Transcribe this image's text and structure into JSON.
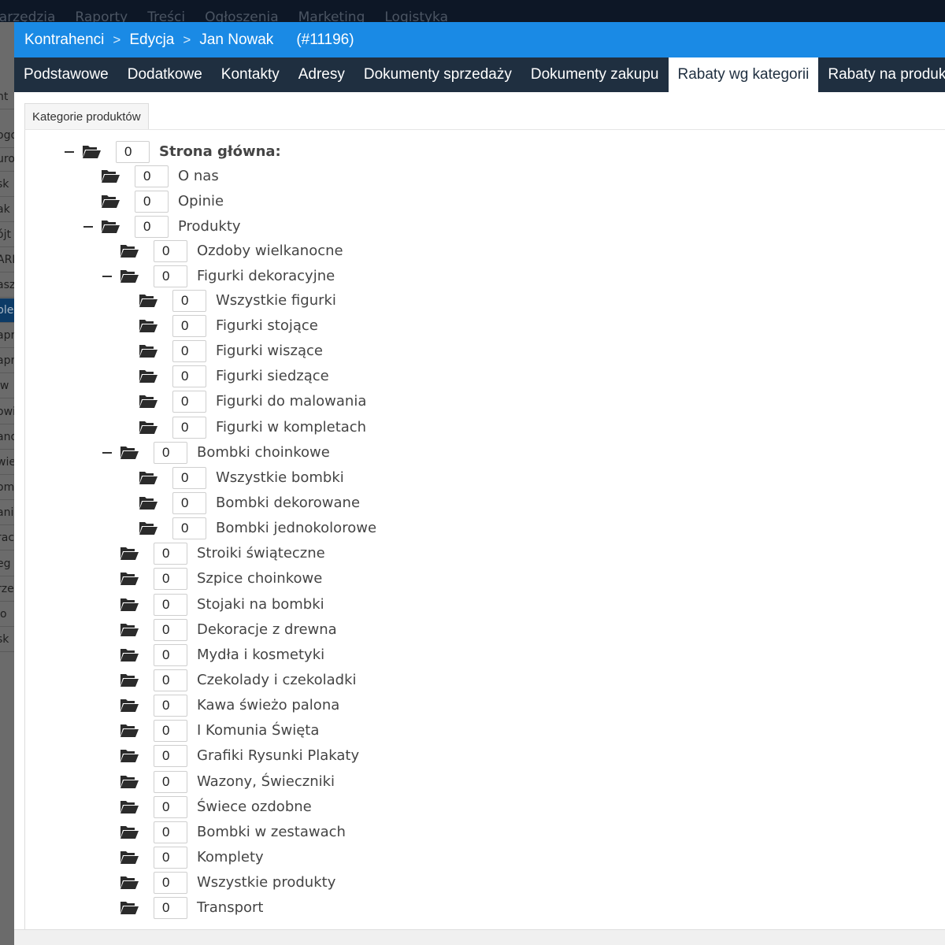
{
  "background": {
    "top_menu": [
      "narzędzia",
      "Raporty",
      "Treści",
      "Ogłoszenia",
      "Marketing",
      "Logistyka"
    ],
    "side_fragments": [
      "nt",
      "ogo",
      "uro",
      "sk",
      "ak",
      "ójt",
      "ARF",
      "asz",
      "ple",
      "apr",
      "apr",
      "iw",
      "owi",
      "and",
      "wie",
      "om",
      "ani",
      "rac",
      "eg",
      "rze",
      "ło",
      "sk"
    ]
  },
  "breadcrumb": {
    "items": [
      "Kontrahenci",
      "Edycja",
      "Jan Nowak"
    ],
    "separator": ">",
    "record": "(#11196)"
  },
  "tabs": [
    {
      "label": "Podstawowe"
    },
    {
      "label": "Dodatkowe"
    },
    {
      "label": "Kontakty"
    },
    {
      "label": "Adresy"
    },
    {
      "label": "Dokumenty sprzedaży"
    },
    {
      "label": "Dokumenty zakupu"
    },
    {
      "label": "Rabaty wg kategorii",
      "active": true
    },
    {
      "label": "Rabaty na produkty"
    }
  ],
  "subtab": "Kategorie produktów",
  "tree": [
    {
      "label": "Strona główna:",
      "value": "0",
      "level": 0,
      "expanded": true,
      "root": true
    },
    {
      "label": "O nas",
      "value": "0",
      "level": 1
    },
    {
      "label": "Opinie",
      "value": "0",
      "level": 1
    },
    {
      "label": "Produkty",
      "value": "0",
      "level": 1,
      "expanded": true
    },
    {
      "label": "Ozdoby wielkanocne",
      "value": "0",
      "level": 2
    },
    {
      "label": "Figurki dekoracyjne",
      "value": "0",
      "level": 2,
      "expanded": true
    },
    {
      "label": "Wszystkie figurki",
      "value": "0",
      "level": 3
    },
    {
      "label": "Figurki stojące",
      "value": "0",
      "level": 3
    },
    {
      "label": "Figurki wiszące",
      "value": "0",
      "level": 3
    },
    {
      "label": "Figurki siedzące",
      "value": "0",
      "level": 3
    },
    {
      "label": "Figurki do malowania",
      "value": "0",
      "level": 3
    },
    {
      "label": "Figurki w kompletach",
      "value": "0",
      "level": 3
    },
    {
      "label": "Bombki choinkowe",
      "value": "0",
      "level": 2,
      "expanded": true
    },
    {
      "label": "Wszystkie bombki",
      "value": "0",
      "level": 3
    },
    {
      "label": "Bombki dekorowane",
      "value": "0",
      "level": 3
    },
    {
      "label": "Bombki jednokolorowe",
      "value": "0",
      "level": 3
    },
    {
      "label": "Stroiki świąteczne",
      "value": "0",
      "level": 2
    },
    {
      "label": "Szpice choinkowe",
      "value": "0",
      "level": 2
    },
    {
      "label": "Stojaki na bombki",
      "value": "0",
      "level": 2
    },
    {
      "label": "Dekoracje z drewna",
      "value": "0",
      "level": 2
    },
    {
      "label": "Mydła i kosmetyki",
      "value": "0",
      "level": 2
    },
    {
      "label": "Czekolady i czekoladki",
      "value": "0",
      "level": 2
    },
    {
      "label": "Kawa świeżo palona",
      "value": "0",
      "level": 2
    },
    {
      "label": "I Komunia Święta",
      "value": "0",
      "level": 2
    },
    {
      "label": "Grafiki Rysunki Plakaty",
      "value": "0",
      "level": 2
    },
    {
      "label": "Wazony, Świeczniki",
      "value": "0",
      "level": 2
    },
    {
      "label": "Świece ozdobne",
      "value": "0",
      "level": 2
    },
    {
      "label": "Bombki w zestawach",
      "value": "0",
      "level": 2
    },
    {
      "label": "Komplety",
      "value": "0",
      "level": 2
    },
    {
      "label": "Wszystkie produkty",
      "value": "0",
      "level": 2
    },
    {
      "label": "Transport",
      "value": "0",
      "level": 2
    }
  ],
  "colors": {
    "titlebar": "#1a8ae5",
    "tabbar": "#1f2f40",
    "folder_icon": "#2b2b2b"
  },
  "icons": {
    "folder": "folder-open-icon",
    "collapse": "minus-icon"
  }
}
